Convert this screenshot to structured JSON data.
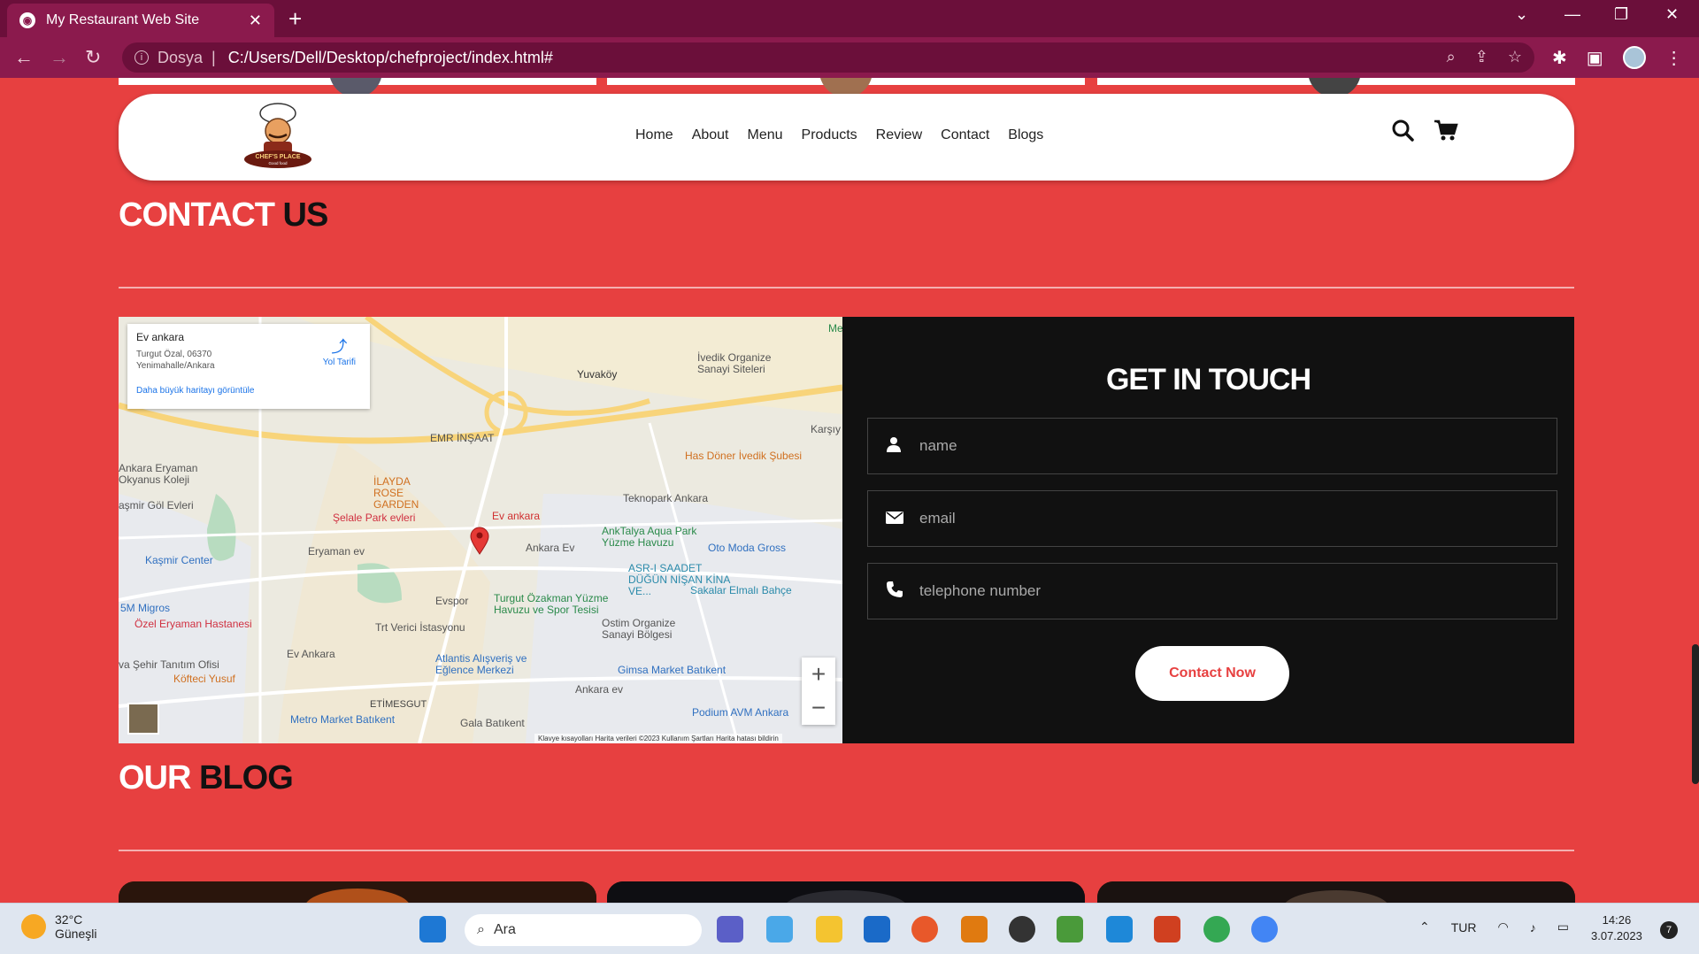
{
  "browser": {
    "tab_title": "My Restaurant Web Site",
    "address_scheme": "Dosya",
    "address_url": "C:/Users/Dell/Desktop/chefproject/index.html#"
  },
  "header": {
    "logo_text": "CHEF'S PLACE",
    "logo_subtext": "Good food",
    "nav": [
      "Home",
      "About",
      "Menu",
      "Products",
      "Review",
      "Contact",
      "Blogs"
    ]
  },
  "contact_section": {
    "title_word1": "CONTACT",
    "title_word2": "US"
  },
  "map": {
    "card_title": "Ev ankara",
    "card_address": "Turgut Özal, 06370 Yenimahalle/Ankara",
    "card_link": "Daha büyük haritayı görüntüle",
    "directions_label": "Yol Tarifi",
    "footer": "Klavye kısayolları   Harita verileri ©2023   Kullanım Şartları   Harita hatası bildirin",
    "labels": [
      "Yuvaköy",
      "İvedik Organize Sanayi Siteleri",
      "EMR İNŞAAT",
      "Has Döner İvedik Şubesi",
      "Ankara Eryaman Okyanus Koleji",
      "İLAYDA ROSE GARDEN",
      "Şelale Park evleri",
      "Ev ankara",
      "Teknopark Ankara",
      "AnkTalya Aqua Park Yüzme Havuzu",
      "Eryaman ev",
      "Ankara Ev",
      "Oto Moda Gross",
      "Kaşmir Center",
      "ASR-I SAADET DÜĞÜN NİŞAN KİNA VE...",
      "Sakalar Elmalı Bahçe",
      "Evspor",
      "Turgut Özakman Yüzme Havuzu ve Spor Tesisi",
      "Trt Verici İstasyonu",
      "Ostim Organize Sanayi Bölgesi",
      "Özel Eryaman Hastanesi",
      "Ev Ankara",
      "Atlantis Alışveriş ve Eğlence Merkezi",
      "Gimsa Market Batıkent",
      "Köfteci Yusuf",
      "Ankara ev",
      "ETİMESGUT",
      "Metro Market Batıkent",
      "Gala Batıkent",
      "Podium AVM Ankara",
      "5M Migros",
      "Karşıy",
      "aşmir Göl Evleri",
      "va Şehir Tanıtım Ofisi",
      "Me"
    ]
  },
  "form": {
    "title": "GET IN TOUCH",
    "name_placeholder": "name",
    "email_placeholder": "email",
    "phone_placeholder": "telephone number",
    "submit_label": "Contact Now"
  },
  "blog_section": {
    "title_word1": "OUR",
    "title_word2": "BLOG"
  },
  "taskbar": {
    "temperature": "32°C",
    "weather": "Güneşli",
    "search_placeholder": "Ara",
    "language": "TUR",
    "time": "14:26",
    "date": "3.07.2023",
    "notifications": "7"
  },
  "colors": {
    "page_bg": "#e74040",
    "accent_dark": "#111111",
    "browser_frame": "#6b0f3a"
  }
}
